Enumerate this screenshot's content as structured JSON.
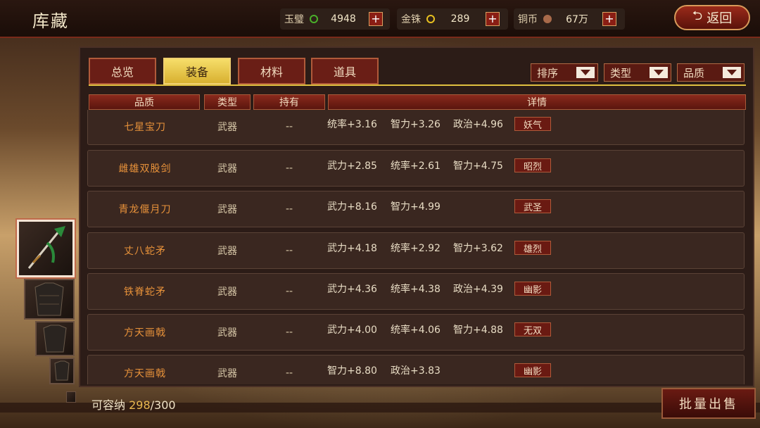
{
  "title": "库藏",
  "currencies": [
    {
      "name": "玉璧",
      "value": "4948",
      "coin_color": "#4ab02a",
      "plus": "+"
    },
    {
      "name": "金铢",
      "value": "289",
      "coin_color": "#e8c020",
      "plus": "+"
    },
    {
      "name": "铜币",
      "value": "67万",
      "coin_color": "#a86a4a",
      "plus": "+"
    }
  ],
  "back_label": "返回",
  "tabs": [
    {
      "label": "总览",
      "active": false
    },
    {
      "label": "装备",
      "active": true
    },
    {
      "label": "材料",
      "active": false
    },
    {
      "label": "道具",
      "active": false
    }
  ],
  "filters": [
    "排序",
    "类型",
    "品质"
  ],
  "columns": [
    "品质",
    "类型",
    "持有",
    "详情"
  ],
  "items": [
    {
      "name": "七星宝刀",
      "type": "武器",
      "hold": "--",
      "stats": [
        "统率+3.16",
        "智力+3.26",
        "政治+4.96"
      ],
      "trait": "妖气"
    },
    {
      "name": "雌雄双股剑",
      "type": "武器",
      "hold": "--",
      "stats": [
        "武力+2.85",
        "统率+2.61",
        "智力+4.75"
      ],
      "trait": "昭烈"
    },
    {
      "name": "青龙偃月刀",
      "type": "武器",
      "hold": "--",
      "stats": [
        "武力+8.16",
        "智力+4.99",
        ""
      ],
      "trait": "武圣"
    },
    {
      "name": "丈八蛇矛",
      "type": "武器",
      "hold": "--",
      "stats": [
        "武力+4.18",
        "统率+2.92",
        "智力+3.62"
      ],
      "trait": "雄烈"
    },
    {
      "name": "铁脊蛇矛",
      "type": "武器",
      "hold": "--",
      "stats": [
        "武力+4.36",
        "统率+4.38",
        "政治+4.39"
      ],
      "trait": "幽影"
    },
    {
      "name": "方天画戟",
      "type": "武器",
      "hold": "--",
      "stats": [
        "武力+4.00",
        "统率+4.06",
        "智力+4.88"
      ],
      "trait": "无双"
    },
    {
      "name": "方天画戟",
      "type": "武器",
      "hold": "--",
      "stats": [
        "智力+8.80",
        "政治+3.83",
        ""
      ],
      "trait": "幽影"
    }
  ],
  "capacity": {
    "label": "可容纳",
    "current": "298",
    "max": "/300"
  },
  "sell_label": "批量出售"
}
